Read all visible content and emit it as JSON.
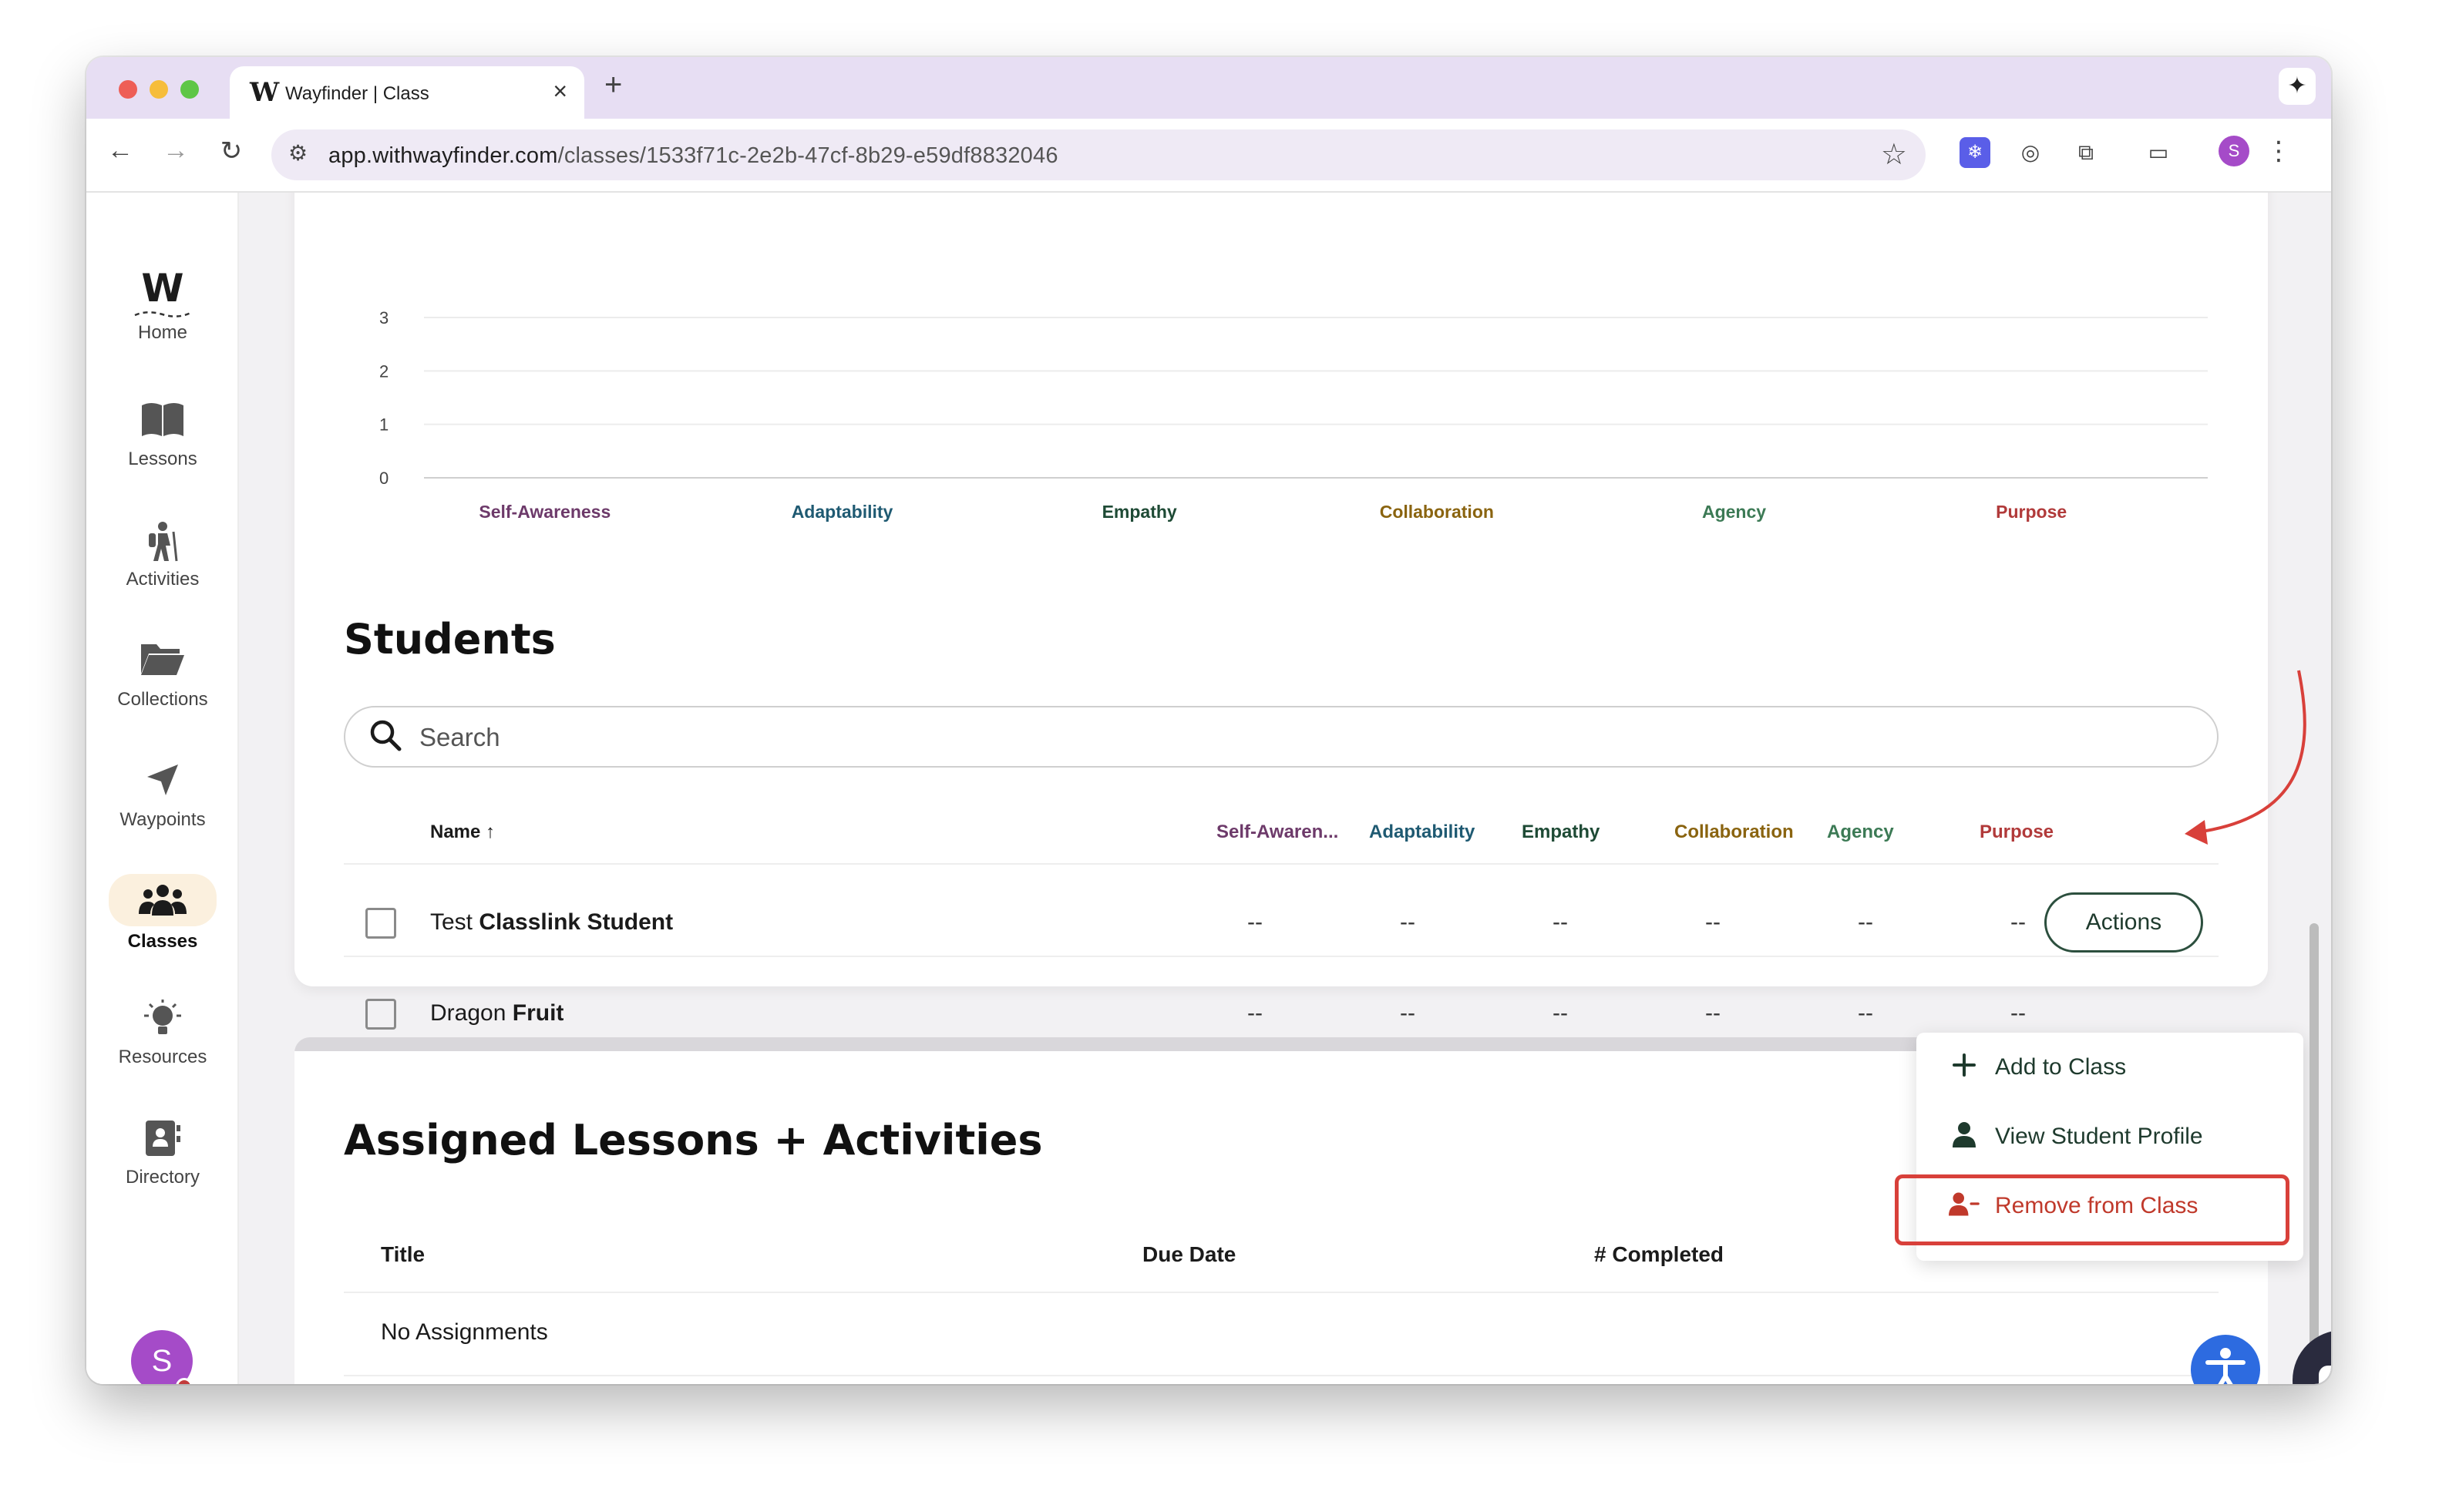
{
  "browser": {
    "tab_title": "Wayfinder | Class",
    "tab_favicon": "W",
    "url_host": "app.withwayfinder.com",
    "url_path": "/classes/1533f71c-2e2b-47cf-8b29-e59df8832046",
    "profile_initial": "S"
  },
  "sidebar": {
    "logo": "W",
    "items": [
      {
        "label": "Home",
        "icon": "home-logo"
      },
      {
        "label": "Lessons",
        "icon": "book-icon"
      },
      {
        "label": "Activities",
        "icon": "hiker-icon"
      },
      {
        "label": "Collections",
        "icon": "folder-icon"
      },
      {
        "label": "Waypoints",
        "icon": "navigation-arrow-icon"
      },
      {
        "label": "Classes",
        "icon": "people-icon"
      },
      {
        "label": "Resources",
        "icon": "lightbulb-icon"
      },
      {
        "label": "Directory",
        "icon": "contact-book-icon"
      }
    ],
    "avatar_initial": "S"
  },
  "chart_data": {
    "type": "bar",
    "categories": [
      "Self-Awareness",
      "Adaptability",
      "Empathy",
      "Collaboration",
      "Agency",
      "Purpose"
    ],
    "values": [
      0,
      0,
      0,
      0,
      0,
      0
    ],
    "yticks": [
      "3",
      "2",
      "1",
      "0"
    ],
    "ylim": [
      0,
      3
    ],
    "category_colors": [
      "#6d3a6a",
      "#1f5a72",
      "#1e4a35",
      "#8a6410",
      "#3c7a55",
      "#b13a3a"
    ]
  },
  "students": {
    "title": "Students",
    "search_placeholder": "Search",
    "columns": {
      "name": "Name ↑",
      "self_awareness": "Self-Awaren...",
      "adaptability": "Adaptability",
      "empathy": "Empathy",
      "collaboration": "Collaboration",
      "agency": "Agency",
      "purpose": "Purpose"
    },
    "rows": [
      {
        "first": "Test",
        "last": "Classlink Student",
        "scores": [
          "--",
          "--",
          "--",
          "--",
          "--",
          "--"
        ]
      },
      {
        "first": "Dragon",
        "last": "Fruit",
        "scores": [
          "--",
          "--",
          "--",
          "--",
          "--",
          "--"
        ]
      }
    ],
    "actions_label": "Actions"
  },
  "actions_menu": {
    "items": [
      {
        "label": "Add to Class",
        "icon": "plus-icon"
      },
      {
        "label": "View Student Profile",
        "icon": "person-icon"
      },
      {
        "label": "Remove from Class",
        "icon": "person-remove-icon"
      }
    ]
  },
  "assigned": {
    "title": "Assigned Lessons + Activities",
    "columns": {
      "title": "Title",
      "due_date": "Due Date",
      "completed": "# Completed"
    },
    "empty_text": "No Assignments"
  },
  "colors": {
    "accent_dark_green": "#2c4f3e",
    "remove_red": "#c0392b",
    "highlight_red": "#d8403a",
    "active_nav_bg": "#fbf0de",
    "avatar_purple": "#a54bc8"
  }
}
